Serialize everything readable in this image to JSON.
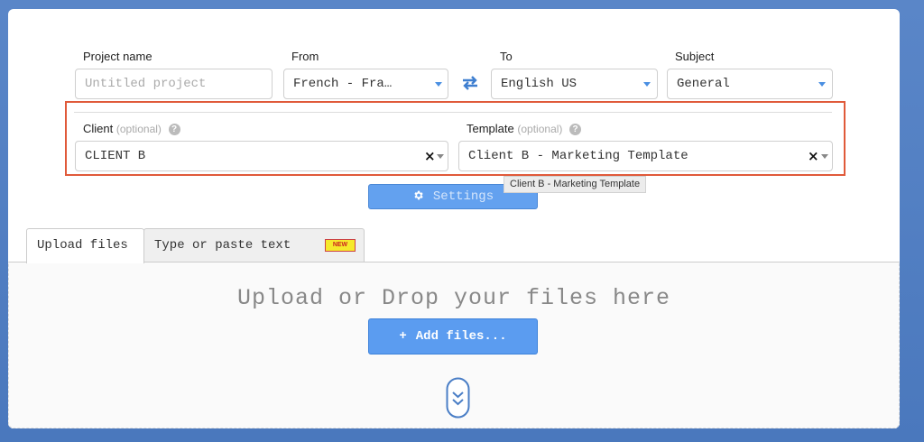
{
  "form": {
    "project_name": {
      "label": "Project name",
      "value": "",
      "placeholder": "Untitled project"
    },
    "from": {
      "label": "From",
      "value": "French - Fra…"
    },
    "to": {
      "label": "To",
      "value": "English US"
    },
    "subject": {
      "label": "Subject",
      "value": "General"
    },
    "client": {
      "label": "Client",
      "optional": "(optional)",
      "help": "?",
      "value": "CLIENT B",
      "clear": "×"
    },
    "template": {
      "label": "Template",
      "optional": "(optional)",
      "help": "?",
      "value": "Client B - Marketing Template",
      "clear": "×"
    }
  },
  "settings_button": {
    "icon": "gear-icon",
    "label": "Settings"
  },
  "tooltip": "Client B - Marketing Template",
  "tabs": [
    {
      "label": "Upload files",
      "active": true
    },
    {
      "label": "Type or paste text",
      "active": false,
      "badge": "NEW"
    }
  ],
  "dropzone": {
    "title": "Upload or Drop your files here",
    "add_button": "Add files...",
    "add_icon": "+"
  },
  "colors": {
    "accent": "#5b9cf0",
    "highlight_border": "#e05a3a",
    "background": "#4f7fc4"
  }
}
